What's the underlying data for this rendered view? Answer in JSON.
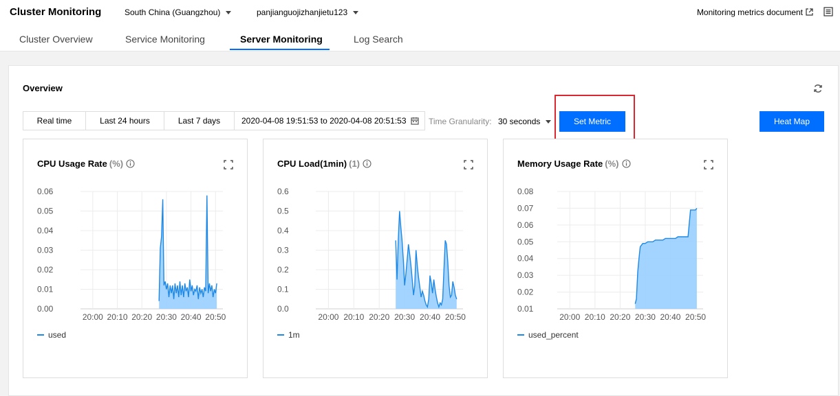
{
  "header": {
    "title": "Cluster Monitoring",
    "region": "South China (Guangzhou)",
    "cluster": "panjianguojizhanjietu123",
    "doc_link": "Monitoring metrics document"
  },
  "tabs": [
    {
      "label": "Cluster Overview"
    },
    {
      "label": "Service Monitoring"
    },
    {
      "label": "Server Monitoring",
      "active": true
    },
    {
      "label": "Log Search"
    }
  ],
  "overview": {
    "title": "Overview",
    "time_buttons": [
      "Real time",
      "Last 24 hours",
      "Last 7 days"
    ],
    "date_range": "2020-04-08 19:51:53 to 2020-04-08 20:51:53",
    "granularity_label": "Time Granularity:",
    "granularity_value": "30 seconds",
    "set_metric": "Set Metric",
    "heat_map": "Heat Map"
  },
  "colors": {
    "accent": "#006eff",
    "series": "#1e88e5",
    "highlight": "#d9262f"
  },
  "chart_data": [
    {
      "type": "area",
      "title": "CPU Usage Rate",
      "unit": "(%)",
      "x_ticks": [
        "20:00",
        "20:10",
        "20:20",
        "20:30",
        "20:40",
        "20:50"
      ],
      "y_ticks": [
        "0.00",
        "0.01",
        "0.02",
        "0.03",
        "0.04",
        "0.05",
        "0.06"
      ],
      "ylim": [
        0,
        0.06
      ],
      "series": [
        {
          "name": "used",
          "x": [
            "20:27:00",
            "20:27:30",
            "20:28:00",
            "20:28:30",
            "20:29:00",
            "20:29:30",
            "20:30:00",
            "20:30:30",
            "20:31:00",
            "20:31:30",
            "20:32:00",
            "20:32:30",
            "20:33:00",
            "20:33:30",
            "20:34:00",
            "20:34:30",
            "20:35:00",
            "20:35:30",
            "20:36:00",
            "20:36:30",
            "20:37:00",
            "20:37:30",
            "20:38:00",
            "20:38:30",
            "20:39:00",
            "20:39:30",
            "20:40:00",
            "20:40:30",
            "20:41:00",
            "20:41:30",
            "20:42:00",
            "20:42:30",
            "20:43:00",
            "20:43:30",
            "20:44:00",
            "20:44:30",
            "20:45:00",
            "20:45:30",
            "20:46:00",
            "20:46:30",
            "20:47:00",
            "20:47:30",
            "20:48:00",
            "20:48:30",
            "20:49:00",
            "20:49:30",
            "20:50:00",
            "20:50:30"
          ],
          "values": [
            0.004,
            0.031,
            0.037,
            0.056,
            0.012,
            0.014,
            0.01,
            0.013,
            0.006,
            0.012,
            0.008,
            0.012,
            0.005,
            0.013,
            0.008,
            0.012,
            0.006,
            0.014,
            0.007,
            0.012,
            0.006,
            0.013,
            0.009,
            0.011,
            0.006,
            0.015,
            0.009,
            0.012,
            0.007,
            0.01,
            0.009,
            0.012,
            0.005,
            0.011,
            0.008,
            0.01,
            0.006,
            0.011,
            0.009,
            0.058,
            0.008,
            0.013,
            0.009,
            0.012,
            0.006,
            0.01,
            0.008,
            0.013
          ]
        }
      ]
    },
    {
      "type": "area",
      "title": "CPU Load(1min)",
      "unit": "(1)",
      "x_ticks": [
        "20:00",
        "20:10",
        "20:20",
        "20:30",
        "20:40",
        "20:50"
      ],
      "y_ticks": [
        "0.0",
        "0.1",
        "0.2",
        "0.3",
        "0.4",
        "0.5",
        "0.6"
      ],
      "ylim": [
        0,
        0.6
      ],
      "series": [
        {
          "name": "1m",
          "x": [
            "20:26:30",
            "20:27:00",
            "20:27:30",
            "20:28:00",
            "20:28:30",
            "20:29:00",
            "20:29:30",
            "20:30:00",
            "20:30:30",
            "20:31:00",
            "20:31:30",
            "20:32:00",
            "20:32:30",
            "20:33:00",
            "20:33:30",
            "20:34:00",
            "20:34:30",
            "20:35:00",
            "20:35:30",
            "20:36:00",
            "20:36:30",
            "20:37:00",
            "20:37:30",
            "20:38:00",
            "20:38:30",
            "20:39:00",
            "20:39:30",
            "20:40:00",
            "20:40:30",
            "20:41:00",
            "20:41:30",
            "20:42:00",
            "20:42:30",
            "20:43:00",
            "20:43:30",
            "20:44:00",
            "20:44:30",
            "20:45:00",
            "20:45:30",
            "20:46:00",
            "20:46:30",
            "20:47:00",
            "20:47:30",
            "20:48:00",
            "20:48:30",
            "20:49:00",
            "20:49:30",
            "20:50:00",
            "20:50:30"
          ],
          "values": [
            0.35,
            0.15,
            0.35,
            0.5,
            0.42,
            0.35,
            0.25,
            0.12,
            0.18,
            0.25,
            0.33,
            0.28,
            0.22,
            0.15,
            0.07,
            0.12,
            0.3,
            0.22,
            0.16,
            0.11,
            0.06,
            0.09,
            0.07,
            0.04,
            0.02,
            0.01,
            0.05,
            0.17,
            0.13,
            0.08,
            0.15,
            0.1,
            0.06,
            0.03,
            0.01,
            0.03,
            0.02,
            0.05,
            0.2,
            0.35,
            0.33,
            0.24,
            0.12,
            0.06,
            0.07,
            0.14,
            0.11,
            0.07,
            0.05
          ]
        }
      ]
    },
    {
      "type": "area",
      "title": "Memory Usage Rate",
      "unit": "(%)",
      "x_ticks": [
        "20:00",
        "20:10",
        "20:20",
        "20:30",
        "20:40",
        "20:50"
      ],
      "y_ticks": [
        "0.01",
        "0.02",
        "0.03",
        "0.04",
        "0.05",
        "0.06",
        "0.07",
        "0.08"
      ],
      "ylim": [
        0.01,
        0.08
      ],
      "series": [
        {
          "name": "used_percent",
          "x": [
            "20:26:00",
            "20:26:30",
            "20:27:00",
            "20:27:30",
            "20:28:00",
            "20:28:30",
            "20:29:00",
            "20:30:00",
            "20:31:00",
            "20:32:00",
            "20:33:00",
            "20:34:00",
            "20:35:00",
            "20:36:00",
            "20:37:00",
            "20:38:00",
            "20:39:00",
            "20:40:00",
            "20:41:00",
            "20:42:00",
            "20:43:00",
            "20:44:00",
            "20:45:00",
            "20:46:00",
            "20:47:00",
            "20:48:00",
            "20:49:00",
            "20:50:00",
            "20:50:30"
          ],
          "values": [
            0.013,
            0.016,
            0.032,
            0.04,
            0.047,
            0.048,
            0.049,
            0.049,
            0.05,
            0.05,
            0.05,
            0.051,
            0.051,
            0.051,
            0.051,
            0.052,
            0.052,
            0.052,
            0.052,
            0.052,
            0.053,
            0.053,
            0.053,
            0.053,
            0.053,
            0.069,
            0.069,
            0.069,
            0.07
          ]
        }
      ]
    }
  ]
}
